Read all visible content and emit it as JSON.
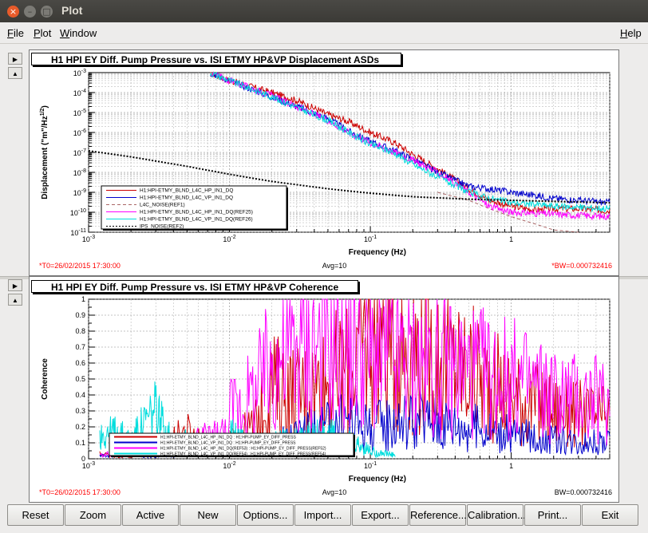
{
  "window": {
    "title": "Plot"
  },
  "menu": {
    "file": "File",
    "plot": "Plot",
    "window": "Window",
    "help": "Help"
  },
  "buttons": [
    "Reset",
    "Zoom",
    "Active",
    "New",
    "Options...",
    "Import...",
    "Export...",
    "Reference...",
    "Calibration...",
    "Print...",
    "Exit"
  ],
  "chart_data": [
    {
      "type": "line",
      "title": "H1 HPI EY Diff. Pump Pressure vs. ISI ETMY HP&VP Displacement ASDs",
      "xlabel": "Frequency (Hz)",
      "ylabel": "Displacement (\"m\"/Hz^1/2)",
      "xscale": "log",
      "yscale": "log",
      "xlim": [
        0.001,
        5
      ],
      "ylim": [
        1e-11,
        0.001
      ],
      "xticks": [
        "10^-3",
        "10^-2",
        "10^-1",
        "1"
      ],
      "yticks": [
        "10^-3",
        "10^-4",
        "10^-5",
        "10^-6",
        "10^-7",
        "10^-8",
        "10^-9",
        "10^-10",
        "10^-11"
      ],
      "grid": true,
      "legend_position": "bottom-left",
      "footer_left": "*T0=26/02/2015 17:30:00",
      "footer_center": "Avg=10",
      "footer_right": "*BW=0.000732416",
      "series": [
        {
          "name": "H1:HPI-ETMY_BLND_L4C_HP_IN1_DQ",
          "color": "#cc0000",
          "style": "solid",
          "x": [
            0.0073,
            0.01,
            0.02,
            0.03,
            0.05,
            0.07,
            0.1,
            0.15,
            0.2,
            0.3,
            0.5,
            0.7,
            1,
            1.5,
            2,
            3,
            5
          ],
          "y": [
            0.001,
            0.0004,
            0.0001,
            4e-05,
            8e-06,
            3.5e-06,
            1e-06,
            3e-07,
            8e-08,
            1.5e-08,
            1.5e-09,
            4e-10,
            2e-10,
            1.3e-10,
            1.5e-10,
            1.5e-10,
            1.2e-10
          ]
        },
        {
          "name": "H1:HPI-ETMY_BLND_L4C_VP_IN1_DQ",
          "color": "#0000cc",
          "style": "solid",
          "x": [
            0.0073,
            0.01,
            0.02,
            0.03,
            0.05,
            0.07,
            0.1,
            0.15,
            0.2,
            0.3,
            0.5,
            0.7,
            1,
            1.5,
            2,
            3,
            5
          ],
          "y": [
            0.001,
            0.0004,
            6e-05,
            2e-05,
            5e-06,
            1.2e-06,
            3.5e-07,
            1.2e-07,
            4.5e-08,
            1e-08,
            2e-09,
            1.5e-09,
            1e-09,
            7e-10,
            5e-10,
            4e-10,
            3e-10
          ]
        },
        {
          "name": "L4C_NOISE(REF1)",
          "color": "#aa6666",
          "style": "dashed",
          "x": [
            0.3,
            0.5,
            0.7,
            1,
            1.5,
            2,
            3
          ],
          "y": [
            1e-09,
            4e-10,
            1.5e-10,
            6e-11,
            2.5e-11,
            1.3e-11,
            1e-11
          ]
        },
        {
          "name": "H1:HPI-ETMY_BLND_L4C_HP_IN1_DQ(REF25)",
          "color": "#ff00ff",
          "style": "solid",
          "x": [
            0.0073,
            0.01,
            0.02,
            0.03,
            0.05,
            0.07,
            0.1,
            0.15,
            0.2,
            0.3,
            0.5,
            0.7,
            1,
            1.5,
            2,
            3,
            5
          ],
          "y": [
            0.001,
            0.0004,
            7e-05,
            2e-05,
            4e-06,
            1e-06,
            3e-07,
            1e-07,
            4e-08,
            1e-08,
            1e-09,
            2e-10,
            1e-10,
            9e-11,
            8e-11,
            7e-11,
            6e-11
          ]
        },
        {
          "name": "H1:HPI-ETMY_BLND_L4C_VP_IN1_DQ(REF26)",
          "color": "#00dddd",
          "style": "solid",
          "x": [
            0.0073,
            0.01,
            0.02,
            0.03,
            0.05,
            0.07,
            0.1,
            0.15,
            0.2,
            0.3,
            0.5,
            0.7,
            1,
            1.5,
            2,
            3,
            5
          ],
          "y": [
            0.001,
            0.0004,
            6e-05,
            1.8e-05,
            4e-06,
            1e-06,
            2.5e-07,
            9e-08,
            2.5e-08,
            6e-09,
            1e-09,
            5e-10,
            3e-10,
            2.5e-10,
            2e-10,
            1.8e-10,
            1.5e-10
          ]
        },
        {
          "name": "IPS_NOISE(REF2)",
          "color": "#000000",
          "style": "dotted",
          "x": [
            0.001,
            0.002,
            0.005,
            0.01,
            0.02,
            0.05,
            0.1,
            0.2,
            0.5,
            1,
            2,
            5
          ],
          "y": [
            1.2e-07,
            6e-08,
            2e-08,
            8e-09,
            3.5e-09,
            1.5e-09,
            9e-10,
            6e-10,
            4.5e-10,
            4e-10,
            3.5e-10,
            3e-10
          ]
        }
      ]
    },
    {
      "type": "line",
      "title": "H1 HPI EY Diff. Pump Pressure vs. ISI ETMY HP&VP Coherence",
      "xlabel": "Frequency (Hz)",
      "ylabel": "Coherence",
      "xscale": "log",
      "xlim": [
        0.001,
        5
      ],
      "ylim": [
        0,
        1
      ],
      "xticks": [
        "10^-3",
        "10^-2",
        "10^-1",
        "1"
      ],
      "yticks": [
        "0",
        "0.1",
        "0.2",
        "0.3",
        "0.4",
        "0.5",
        "0.6",
        "0.7",
        "0.8",
        "0.9",
        "1"
      ],
      "grid": true,
      "legend_position": "bottom-center",
      "footer_left": "*T0=26/02/2015 17:30:00",
      "footer_center": "Avg=10",
      "footer_right": "BW=0.000732416",
      "series": [
        {
          "name": "H1:HPI-ETMY_BLND_L4C_HP_IN1_DQ : H1:HPI-PUMP_EY_DIFF_PRESS",
          "color": "#cc0000",
          "style": "solid",
          "x": [
            0.0012,
            0.002,
            0.003,
            0.005,
            0.007,
            0.01,
            0.015,
            0.02,
            0.03,
            0.05,
            0.07,
            0.1,
            0.2,
            0.5,
            1,
            2,
            5
          ],
          "y": [
            0.05,
            0.02,
            0.1,
            0.3,
            0.15,
            0.1,
            0.2,
            0.45,
            0.4,
            0.5,
            0.55,
            0.8,
            0.7,
            0.55,
            0.4,
            0.3,
            0.25
          ]
        },
        {
          "name": "H1:HPI-ETMY_BLND_L4C_VP_IN1_DQ : H1:HPI-PUMP_EY_DIFF_PRESS",
          "color": "#0000cc",
          "style": "solid",
          "x": [
            0.0012,
            0.002,
            0.003,
            0.005,
            0.007,
            0.01,
            0.015,
            0.02,
            0.03,
            0.05,
            0.07,
            0.1,
            0.2,
            0.5,
            1,
            2,
            5
          ],
          "y": [
            0.03,
            0.05,
            0.02,
            0.08,
            0.1,
            0.05,
            0.08,
            0.1,
            0.15,
            0.2,
            0.25,
            0.2,
            0.25,
            0.2,
            0.15,
            0.12,
            0.1
          ]
        },
        {
          "name": "H1:HPI-ETMY_BLND_L4C_HP_IN1_DQ(REF53) : H1:HPI-PUMP_EY_DIFF_PRESS(REF52)",
          "color": "#ff00ff",
          "style": "solid",
          "x": [
            0.0012,
            0.002,
            0.003,
            0.005,
            0.007,
            0.01,
            0.015,
            0.02,
            0.03,
            0.05,
            0.07,
            0.1,
            0.2,
            0.5,
            1,
            2,
            5
          ],
          "y": [
            0.05,
            0.05,
            0.1,
            0.15,
            0.25,
            0.3,
            0.4,
            0.6,
            0.7,
            0.75,
            0.7,
            0.65,
            0.6,
            0.55,
            0.5,
            0.4,
            0.35
          ]
        },
        {
          "name": "H1:HPI-ETMY_BLND_L4C_VP_IN1_DQ(REF54) : H1:HPI-PUMP_EY_DIFF_PRESS(REF54)",
          "color": "#00dddd",
          "style": "solid",
          "x": [
            0.0012,
            0.0015,
            0.002,
            0.003,
            0.004,
            0.005,
            0.007,
            0.01,
            0.015,
            0.02,
            0.03,
            0.05,
            0.07,
            0.1,
            0.15
          ],
          "y": [
            0.25,
            0.28,
            0.2,
            0.5,
            0.15,
            0.2,
            0.1,
            0.15,
            0.08,
            0.1,
            0.12,
            0.15,
            0.1,
            0.05,
            0.02
          ]
        }
      ]
    }
  ]
}
